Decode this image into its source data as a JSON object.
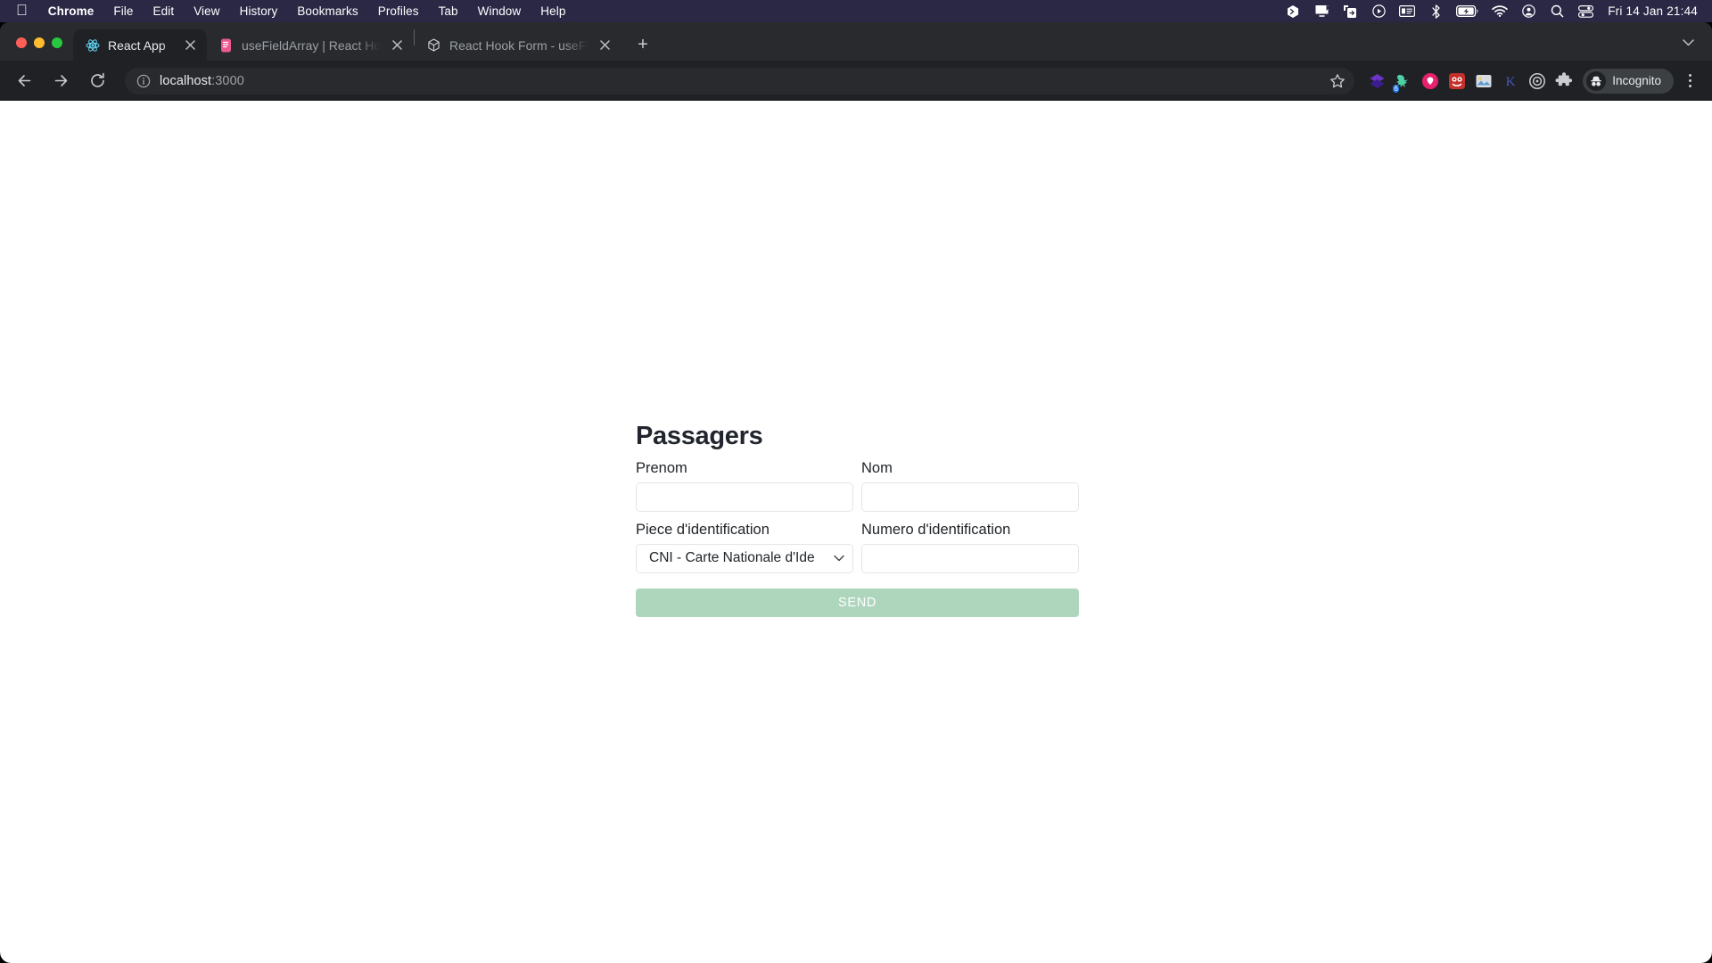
{
  "menubar": {
    "apple_icon": "apple-logo",
    "items": [
      {
        "label": "Chrome",
        "bold": true
      },
      {
        "label": "File",
        "bold": false
      },
      {
        "label": "Edit",
        "bold": false
      },
      {
        "label": "View",
        "bold": false
      },
      {
        "label": "History",
        "bold": false
      },
      {
        "label": "Bookmarks",
        "bold": false
      },
      {
        "label": "Profiles",
        "bold": false
      },
      {
        "label": "Tab",
        "bold": false
      },
      {
        "label": "Window",
        "bold": false
      },
      {
        "label": "Help",
        "bold": false
      }
    ],
    "status_icons": [
      "shortcut-app-icon",
      "display-notification-icon",
      "screen-share-icon",
      "play-circle-icon",
      "media-widget-icon",
      "bluetooth-icon",
      "battery-charging-icon",
      "wifi-icon",
      "user-account-icon",
      "search-icon",
      "control-center-icon"
    ],
    "clock": "Fri 14 Jan  21:44",
    "background_color": "#2b2846"
  },
  "browser": {
    "tabs": [
      {
        "title": "React App",
        "favicon": "react-logo-icon",
        "active": true
      },
      {
        "title": "useFieldArray | React Hook Form",
        "favicon": "react-hook-form-icon",
        "active": false
      },
      {
        "title": "React Hook Form - useFieldArray",
        "favicon": "react-hook-form-dark-icon",
        "active": false
      }
    ],
    "new_tab_label": "+",
    "tab_list_chevron": "chevron-down-icon",
    "nav": {
      "back": "back-arrow-icon",
      "forward": "forward-arrow-icon",
      "reload": "reload-icon"
    },
    "omnibox": {
      "info_icon": "site-info-icon",
      "url_host": "localhost",
      "url_port": ":3000",
      "bookmark_icon": "star-icon"
    },
    "extensions": [
      {
        "name": "purple-diamond-extension-icon",
        "color": "#6b35c9"
      },
      {
        "name": "green-dino-extension-icon",
        "color": "#4fd1a5",
        "badge": "6"
      },
      {
        "name": "pink-circle-extension-icon",
        "color": "#e6216e"
      },
      {
        "name": "red-logo-extension-icon",
        "color": "#c4302b"
      },
      {
        "name": "image-extension-icon",
        "color": "#5b9bd5"
      },
      {
        "name": "letter-k-extension-icon",
        "color": "#4458b8"
      },
      {
        "name": "target-extension-icon",
        "color": "#9aa0a6"
      },
      {
        "name": "puzzle-extensions-icon",
        "color": "#c9ccd0"
      }
    ],
    "profile": {
      "label": "Incognito",
      "icon": "incognito-hat-icon"
    },
    "menu_icon": "kebab-menu-icon"
  },
  "page": {
    "title": "Passagers",
    "fields": [
      {
        "label": "Prenom",
        "type": "text",
        "value": "",
        "placeholder": ""
      },
      {
        "label": "Nom",
        "type": "text",
        "value": "",
        "placeholder": ""
      },
      {
        "label": "Piece d'identification",
        "type": "select",
        "value": "CNI - Carte Nationale d'Ide"
      },
      {
        "label": "Numero d'identification",
        "type": "text",
        "value": "",
        "placeholder": ""
      }
    ],
    "submit_label": "SEND",
    "submit_color": "#aed6bd",
    "submit_disabled": true,
    "background_color": "#ffffff"
  }
}
